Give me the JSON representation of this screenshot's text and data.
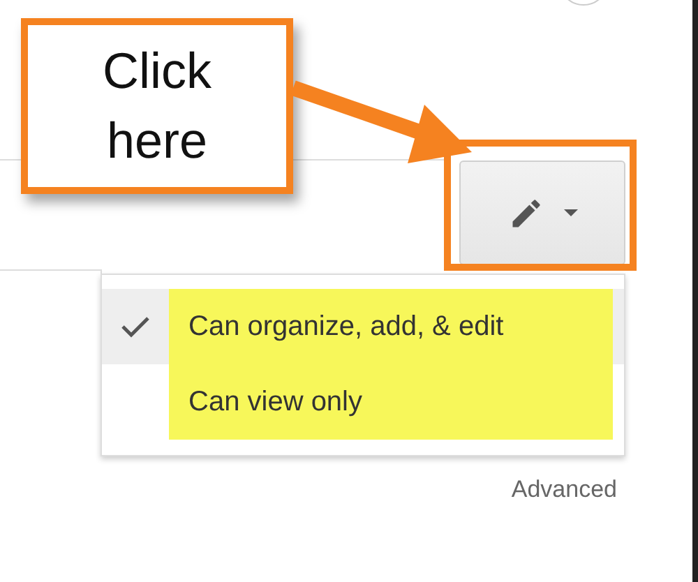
{
  "callout": {
    "text": "Click here"
  },
  "edit_button": {
    "highlighted": true
  },
  "menu": {
    "items": [
      {
        "label": "Can organize, add, & edit",
        "selected": true,
        "highlighted": true
      },
      {
        "label": "Can view only",
        "selected": false,
        "highlighted": true
      }
    ]
  },
  "advanced_link": "Advanced"
}
